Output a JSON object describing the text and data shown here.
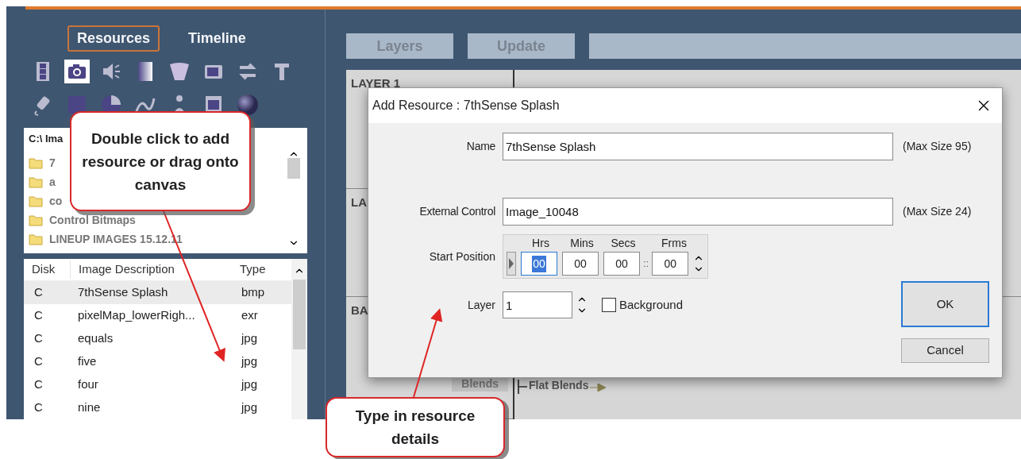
{
  "tabs": [
    {
      "label": "Resources",
      "selected": true
    },
    {
      "label": "Timeline",
      "selected": false
    }
  ],
  "toolbar_rows": [
    [
      {
        "kind": "film",
        "selected": false
      },
      {
        "kind": "camera",
        "selected": true
      },
      {
        "kind": "speaker",
        "selected": false
      },
      {
        "kind": "gradient",
        "selected": false
      },
      {
        "kind": "trapezoid",
        "selected": false
      },
      {
        "kind": "screen",
        "selected": false
      },
      {
        "kind": "swap",
        "selected": false
      },
      {
        "kind": "text",
        "selected": false
      }
    ],
    [
      {
        "kind": "plug",
        "selected": false
      },
      {
        "kind": "square",
        "selected": false
      },
      {
        "kind": "pie",
        "selected": false
      },
      {
        "kind": "curve",
        "selected": false
      },
      {
        "kind": "person",
        "selected": false
      },
      {
        "kind": "panel",
        "selected": false
      },
      {
        "kind": "sphere",
        "selected": false
      }
    ]
  ],
  "folder_browser": {
    "path": "C:\\ Ima",
    "folders": [
      "7",
      "a",
      "co",
      "Control Bitmaps",
      "LINEUP IMAGES 15.12.11"
    ]
  },
  "image_table": {
    "columns": [
      "Disk",
      "Image Description",
      "Type"
    ],
    "rows": [
      {
        "cells": [
          "C",
          "7thSense Splash",
          "bmp"
        ],
        "selected": true
      },
      {
        "cells": [
          "C",
          "pixelMap_lowerRigh...",
          "exr"
        ],
        "selected": false
      },
      {
        "cells": [
          "C",
          "equals",
          "jpg"
        ],
        "selected": false
      },
      {
        "cells": [
          "C",
          "five",
          "jpg"
        ],
        "selected": false
      },
      {
        "cells": [
          "C",
          "four",
          "jpg"
        ],
        "selected": false
      },
      {
        "cells": [
          "C",
          "nine",
          "jpg"
        ],
        "selected": false
      }
    ]
  },
  "timeline": {
    "buttons": [
      "Layers",
      "Update"
    ],
    "sections": [
      "LAYER 1",
      "LA",
      "BA"
    ],
    "blends_button": "Blends",
    "track_label": "Flat Blends"
  },
  "dialog": {
    "title": "Add Resource : 7thSense Splash",
    "fields": [
      {
        "label": "Name",
        "value": "7thSense Splash",
        "hint": "(Max Size 95)"
      },
      {
        "label": "External Control",
        "value": "Image_10048",
        "hint": "(Max Size 24)"
      }
    ],
    "start_position": {
      "label": "Start Position",
      "columns": [
        "Hrs",
        "Mins",
        "Secs",
        "Frms"
      ],
      "values": [
        {
          "value": "00",
          "selected": true
        },
        {
          "value": "00",
          "selected": false
        },
        {
          "value": "00",
          "selected": false
        },
        {
          "value": "00",
          "selected": false
        }
      ],
      "separator": "::"
    },
    "layer": {
      "label": "Layer",
      "value": "1"
    },
    "background": {
      "label": "Background",
      "checked": false
    },
    "buttons": [
      {
        "label": "OK",
        "default": true
      },
      {
        "label": "Cancel",
        "default": false
      }
    ]
  },
  "callouts": [
    "Double click to add resource or drag onto canvas",
    "Type in resource details"
  ]
}
